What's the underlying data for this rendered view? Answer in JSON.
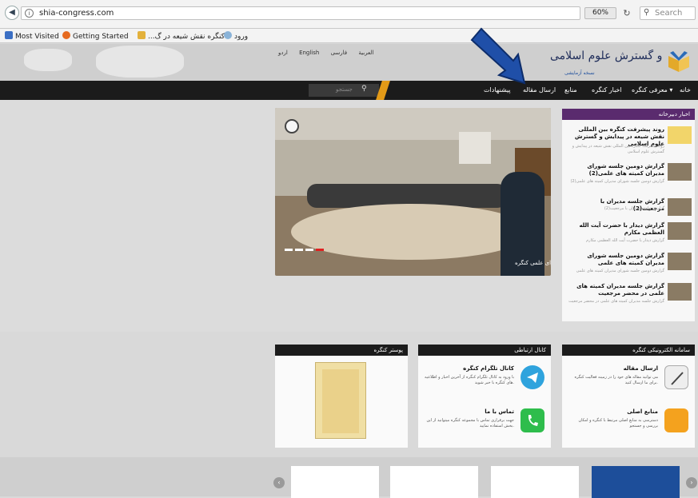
{
  "browser": {
    "url": "shia-congress.com",
    "zoom": "60%",
    "search_placeholder": "Search",
    "bookmarks": [
      {
        "label": "Most Visited",
        "icon": "bookmarks-icon"
      },
      {
        "label": "Getting Started",
        "icon": "firefox-icon"
      },
      {
        "label": "...کنگره نقش شیعه در گ",
        "icon": "site-icon"
      },
      {
        "label": "ورود",
        "icon": "site-icon"
      }
    ]
  },
  "site": {
    "languages": [
      "فارسی",
      "العربية",
      "English",
      "اردو"
    ],
    "beta_label": "نسخه آزمایشی",
    "logo_text": "کنگره بین المللی نقش شیعه در پیدایش و گسترش علوم اسلامی",
    "nav": [
      "خانه",
      "معرفی کنگره",
      "اخبار کنگره",
      "منابع",
      "ارسال مقاله",
      "پیشنهادات"
    ],
    "search_placeholder": "جستجو"
  },
  "slider": {
    "caption": "جلسه شورای علمی کنگره"
  },
  "news": {
    "heading": "اخبار دبیرخانه",
    "items": [
      {
        "title": "روند پیشرفت کنگره بین المللی نقش شیعه در پیدایش و گسترش علوم اسلامی",
        "sub": "روند پیشرفت کنگره بین المللی نقش شیعه در پیدایش و گسترش علوم اسلامی"
      },
      {
        "title": "گزارش دومین جلسه شورای مدیران کمیته های علمی(2)",
        "sub": "گزارش دومین جلسه شورای مدیران کمیته های علمی(2)"
      },
      {
        "title": "گزارش جلسه مدیران با مرجعیت(2)",
        "sub": "گزارش جلسه مدیران با مرجعیت(2)"
      },
      {
        "title": "گزارش دیدار با حضرت آیت الله العظمی مکارم",
        "sub": "گزارش دیدار با حضرت آیت الله العظمی مکارم"
      },
      {
        "title": "گزارش دومین جلسه شورای مدیران کمیته های علمی",
        "sub": "گزارش دومین جلسه شورای مدیران کمیته های علمی"
      },
      {
        "title": "گزارش جلسه مدیران کمیته های علمی در محضر مرجعیت",
        "sub": "گزارش جلسه مدیران کمیته های علمی در محضر مرجعیت"
      }
    ]
  },
  "widgets": {
    "electronic": {
      "heading": "سامانه الکترونیکی کنگره",
      "rows": [
        {
          "title": "ارسال مقاله",
          "desc": "می توانید مقاله های خود را در زمینه فعالیت کنگره برای ما ارسال کنید."
        },
        {
          "title": "منابع اصلی",
          "desc": "دسترسی به منابع اصلی مرتبط با کنگره و امکان بررسی و جستجو"
        }
      ]
    },
    "contact": {
      "heading": "کانال ارتباطی",
      "rows": [
        {
          "title": "کانال تلگرام کنگره",
          "desc": "با ورود به کانال تلگرام کنگره از آخرین اخبار و اطلاعیه های کنگره با خبر شوید."
        },
        {
          "title": "تماس با ما",
          "desc": "جهت برقراری تماس با مجموعه کنگره میتوانید از این بخش استفاده نمایید."
        }
      ]
    },
    "poster": {
      "heading": "پوستر کنگره"
    }
  },
  "colors": {
    "navbar": "#1b1b1b",
    "news_head": "#5a2b6e",
    "accent_orange": "#e39a17",
    "arrow_blue": "#1f4fa8"
  }
}
